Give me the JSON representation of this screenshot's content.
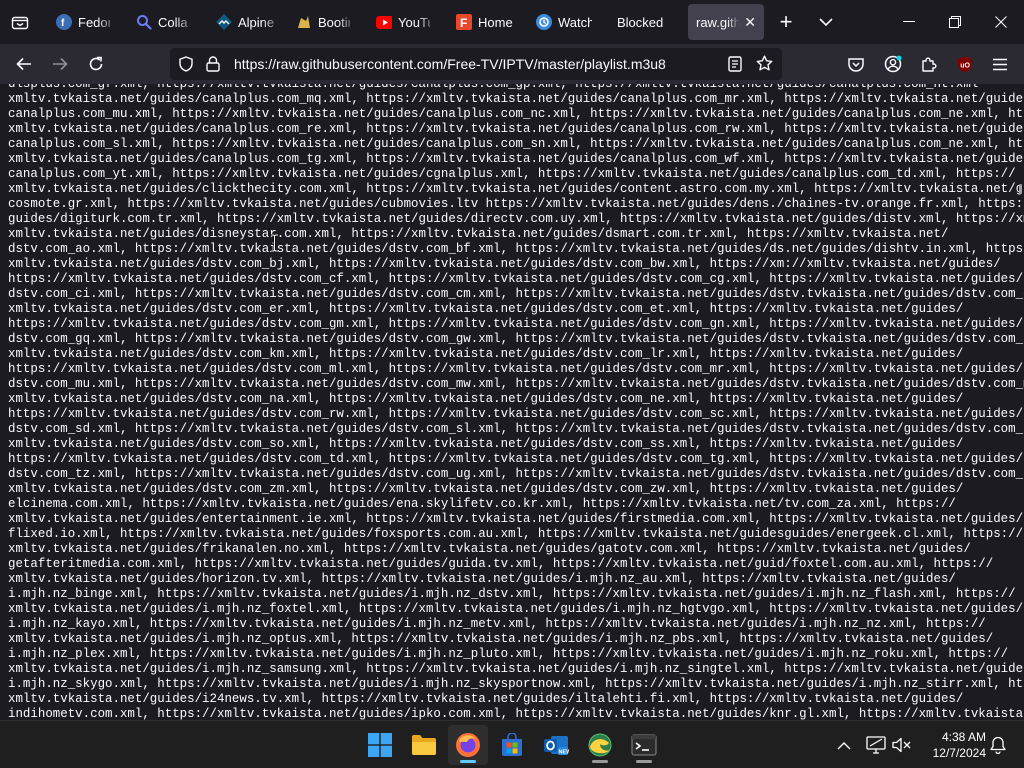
{
  "browser": {
    "tabs": [
      {
        "label": "Fedora",
        "icon": "fedora-icon",
        "color": "#3c6eb4"
      },
      {
        "label": "Collab",
        "icon": "search-icon",
        "color": "#4a6cf7"
      },
      {
        "label": "Alpine",
        "icon": "alpine-icon",
        "color": "#0d597f"
      },
      {
        "label": "Bootin",
        "icon": "bootstrap-icon",
        "color": "#d8b44a"
      },
      {
        "label": "YouTu",
        "icon": "youtube-icon",
        "color": "#ff0000"
      },
      {
        "label": "Home",
        "icon": "home-icon",
        "color": "#e8472b"
      },
      {
        "label": "Watch",
        "icon": "watch-icon",
        "color": "#3a8dde"
      },
      {
        "label": "Blocked",
        "icon": "",
        "color": ""
      },
      {
        "label": "raw.githu",
        "icon": "",
        "color": "",
        "active": true
      }
    ],
    "new_tab_label": "+",
    "url": {
      "full": "https://raw.githubusercontent.com/Free-TV/IPTV/master/playlist.m3u8"
    }
  },
  "colors": {
    "accent": "#60cdff",
    "ublock": "#800000",
    "urlbar_bg": "#1c1b22",
    "toolbar_bg": "#2b2a33"
  },
  "content": {
    "text": "ulsplus.com_gf.xml, https://xmltv.tvkaista.net/guides/canalplus.com_gp.xml, https://xmltv.tvkaista.net/guides/canalplus.com_ht.xml\nxmltv.tvkaista.net/guides/canalplus.com_mq.xml, https://xmltv.tvkaista.net/guides/canalplus.com_mr.xml, https://xmltv.tvkaista.net/guides/\ncanalplus.com_mu.xml, https://xmltv.tvkaista.net/guides/canalplus.com_nc.xml, https://xmltv.tvkaista.net/guides/canalplus.com_ne.xml, https://\nxmltv.tvkaista.net/guides/canalplus.com_re.xml, https://xmltv.tvkaista.net/guides/canalplus.com_rw.xml, https://xmltv.tvkaista.net/guides/\ncanalplus.com_sl.xml, https://xmltv.tvkaista.net/guides/canalplus.com_sn.xml, https://xmltv.tvkaista.net/guides/canalplus.com_ne.xml, https://\nxmltv.tvkaista.net/guides/canalplus.com_tg.xml, https://xmltv.tvkaista.net/guides/canalplus.com_wf.xml, https://xmltv.tvkaista.net/guides/\ncanalplus.com_yt.xml, https://xmltv.tvkaista.net/guides/cgnalplus.xml, https://xmltv.tvkaista.net/guides/canalplus.com_td.xml, https://\nxmltv.tvkaista.net/guides/clickthecity.com.xml, https://xmltv.tvkaista.net/guides/content.astro.com.my.xml, https://xmltv.tvkaista.net/guides/\ncosmote.gr.xml, https://xmltv.tvkaista.net/guides/cubmovies.ltv https://xmltv.tvkaista.net/guides/dens./chaines-tv.orange.fr.xml, https://\nguides/digiturk.com.tr.xml, https://xmltv.tvkaista.net/guides/directv.com.uy.xml, https://xmltv.tvkaista.net/guides/distv.xml, https://xmltv.tvkaista.net/guides/\nxmltv.tvkaista.net/guides/disneystar.com.xml, https://xmltv.tvkaista.net/guides/dsmart.com.tr.xml, https://xmltv.tvkaista.net/\ndstv.com_ao.xml, https://xmltv.tvkaista.net/guides/dstv.com_bf.xml, https://xmltv.tvkaista.net/guides/ds.net/guides/dishtv.in.xml, https://\nxmltv.tvkaista.net/guides/dstv.com_bj.xml, https://xmltv.tvkaista.net/guides/dstv.com_bw.xml, https://xm://xmltv.tvkaista.net/guides/\nhttps://xmltv.tvkaista.net/guides/dstv.com_cf.xml, https://xmltv.tvkaista.net/guides/dstv.com_cg.xml, https://xmltv.tvkaista.net/guides/dstv.com_bi.xml, https://\ndstv.com_ci.xml, https://xmltv.tvkaista.net/guides/dstv.com_cm.xml, https://xmltv.tvkaista.net/guides/dstv.tvkaista.net/guides/dstv.com_cd.xml\nxmltv.tvkaista.net/guides/dstv.com_er.xml, https://xmltv.tvkaista.net/guides/dstv.com_et.xml, https://xmltv.tvkaista.net/guides/        ,\nhttps://xmltv.tvkaista.net/guides/dstv.com_gm.xml, https://xmltv.tvkaista.net/guides/dstv.com_gn.xml, https://xmltv.tvkaista.net/guides/dstv.com_dj.xml, https://\ndstv.com_gq.xml, https://xmltv.tvkaista.net/guides/dstv.com_gw.xml, https://xmltv.tvkaista.net/guides/dstv.tvkaista.net/guides/dstv.com_gh.xml\nxmltv.tvkaista.net/guides/dstv.com_km.xml, https://xmltv.tvkaista.net/guides/dstv.com_lr.xml, https://xmltv.tvkaista.net/guides/        ,\nhttps://xmltv.tvkaista.net/guides/dstv.com_ml.xml, https://xmltv.tvkaista.net/guides/dstv.com_mr.xml, https://xmltv.tvkaista.net/guides/dstv.com_ke.xml, https://\ndstv.com_mu.xml, https://xmltv.tvkaista.net/guides/dstv.com_mw.xml, https://xmltv.tvkaista.net/guides/dstv.tvkaista.net/guides/dstv.com_mg.xml\nxmltv.tvkaista.net/guides/dstv.com_na.xml, https://xmltv.tvkaista.net/guides/dstv.com_ne.xml, https://xmltv.tvkaista.net/guides/        ,\nhttps://xmltv.tvkaista.net/guides/dstv.com_rw.xml, https://xmltv.tvkaista.net/guides/dstv.com_sc.xml, https://xmltv.tvkaista.net/guides/dstv.com_mz.xml, https://\ndstv.com_sd.xml, https://xmltv.tvkaista.net/guides/dstv.com_sl.xml, https://xmltv.tvkaista.net/guides/dstv.tvkaista.net/guides/dstv.com_ng.xml\nxmltv.tvkaista.net/guides/dstv.com_so.xml, https://xmltv.tvkaista.net/guides/dstv.com_ss.xml, https://xmltv.tvkaista.net/guides/        ,\nhttps://xmltv.tvkaista.net/guides/dstv.com_td.xml, https://xmltv.tvkaista.net/guides/dstv.com_tg.xml, https://xmltv.tvkaista.net/guides/dstv.com_sn.xml, https://\ndstv.com_tz.xml, https://xmltv.tvkaista.net/guides/dstv.com_ug.xml, https://xmltv.tvkaista.net/guides/dstv.tvkaista.net/guides/dstv.com_st.xml\nxmltv.tvkaista.net/guides/dstv.com_zm.xml, https://xmltv.tvkaista.net/guides/dstv.com_zw.xml, https://xmltv.tvkaista.net/guides/        ,\nelcinema.com.xml, https://xmltv.tvkaista.net/guides/ena.skylifetv.co.kr.xml, https://xmltv.tvkaista.net/tv.com_za.xml, https://\nxmltv.tvkaista.net/guides/entertainment.ie.xml, https://xmltv.tvkaista.net/guides/firstmedia.com.xml, https://xmltv.tvkaista.net/guides/\nflixed.io.xml, https://xmltv.tvkaista.net/guides/foxsports.com.au.xml, https://xmltv.tvkaista.net/guidesguides/energeek.cl.xml, https://\nxmltv.tvkaista.net/guides/frikanalen.no.xml, https://xmltv.tvkaista.net/guides/gatotv.com.xml, https://xmltv.tvkaista.net/guides/\ngetafteritmedia.com.xml, https://xmltv.tvkaista.net/guides/guida.tv.xml, https://xmltv.tvkaista.net/guid/foxtel.com.au.xml, https://\nxmltv.tvkaista.net/guides/horizon.tv.xml, https://xmltv.tvkaista.net/guides/i.mjh.nz_au.xml, https://xmltv.tvkaista.net/guides/\ni.mjh.nz_binge.xml, https://xmltv.tvkaista.net/guides/i.mjh.nz_dstv.xml, https://xmltv.tvkaista.net/guides/i.mjh.nz_flash.xml, https://\nxmltv.tvkaista.net/guides/i.mjh.nz_foxtel.xml, https://xmltv.tvkaista.net/guides/i.mjh.nz_hgtvgo.xml, https://xmltv.tvkaista.net/guides/\ni.mjh.nz_kayo.xml, https://xmltv.tvkaista.net/guides/i.mjh.nz_metv.xml, https://xmltv.tvkaista.net/guides/i.mjh.nz_nz.xml, https://\nxmltv.tvkaista.net/guides/i.mjh.nz_optus.xml, https://xmltv.tvkaista.net/guides/i.mjh.nz_pbs.xml, https://xmltv.tvkaista.net/guides/\ni.mjh.nz_plex.xml, https://xmltv.tvkaista.net/guides/i.mjh.nz_pluto.xml, https://xmltv.tvkaista.net/guides/i.mjh.nz_roku.xml, https://\nxmltv.tvkaista.net/guides/i.mjh.nz_samsung.xml, https://xmltv.tvkaista.net/guides/i.mjh.nz_singtel.xml, https://xmltv.tvkaista.net/guides/\ni.mjh.nz_skygo.xml, https://xmltv.tvkaista.net/guides/i.mjh.nz_skysportnow.xml, https://xmltv.tvkaista.net/guides/i.mjh.nz_stirr.xml, https://\nxmltv.tvkaista.net/guides/i24news.tv.xml, https://xmltv.tvkaista.net/guides/iltalehti.fi.xml, https://xmltv.tvkaista.net/guides/\nindihometv.com.xml, https://xmltv.tvkaista.net/guides/ipko.com.xml, https://xmltv.tvkaista.net/guides/knr.gl.xml, https://xmltv.tvkaista.net/"
  },
  "taskbar": {
    "apps": [
      {
        "name": "start-button",
        "icon": "windows-icon"
      },
      {
        "name": "file-explorer",
        "icon": "folder-icon"
      },
      {
        "name": "firefox",
        "icon": "firefox-icon",
        "active": true
      },
      {
        "name": "microsoft-store",
        "icon": "store-icon"
      },
      {
        "name": "outlook",
        "icon": "outlook-icon"
      },
      {
        "name": "edge-canary",
        "icon": "edge-icon"
      },
      {
        "name": "terminal",
        "icon": "terminal-icon"
      }
    ],
    "time": "4:38 AM",
    "date": "12/7/2024"
  }
}
